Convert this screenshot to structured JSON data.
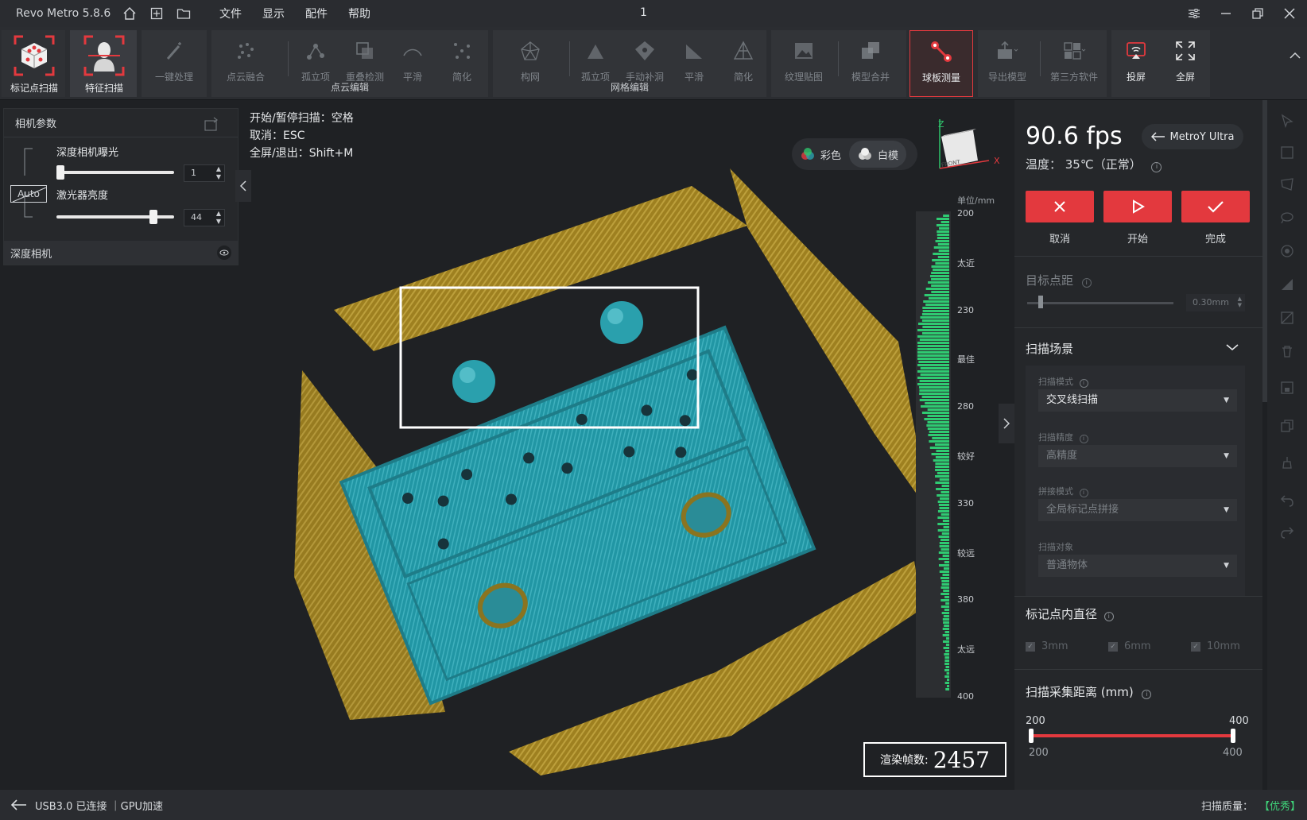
{
  "titlebar": {
    "app_title": "Revo Metro 5.8.6",
    "doc_title": "1",
    "menu": [
      "文件",
      "显示",
      "配件",
      "帮助"
    ],
    "icons": [
      "home-icon",
      "new-project-icon",
      "open-folder-icon"
    ]
  },
  "ribbon": {
    "scan_buttons": [
      "标记点扫描",
      "特征扫描"
    ],
    "one_click": "一键处理",
    "point_cloud_edit": {
      "label": "点云编辑",
      "items": [
        "点云融合",
        "孤立项",
        "重叠检测",
        "平滑",
        "简化"
      ]
    },
    "mesh_edit": {
      "label": "网格编辑",
      "items": [
        "构网",
        "孤立项",
        "手动补洞",
        "平滑",
        "简化"
      ]
    },
    "texture": "纹理贴图",
    "merge": "模型合并",
    "sphere_measure": "球板测量",
    "export": "导出模型",
    "third_party": "第三方软件",
    "cast": "投屏",
    "fullscreen": "全屏"
  },
  "left_panel": {
    "title": "相机参数",
    "auto_label": "Auto",
    "exposure_label": "深度相机曝光",
    "exposure_value": "1",
    "exposure_fraction": 0.0,
    "laser_label": "激光器亮度",
    "laser_value": "44",
    "laser_fraction": 0.85,
    "footer": "深度相机"
  },
  "viewport": {
    "hints": [
      "开始/暂停扫描：空格",
      "取消：ESC",
      "全屏/退出：Shift+M"
    ],
    "mode_color": "彩色",
    "mode_white": "白模",
    "cube_label": "FRONT",
    "axis_z": "Z",
    "axis_x": "X",
    "scale_unit": "单位/mm",
    "scale_labels": [
      "200",
      "太近",
      "230",
      "最佳",
      "280",
      "较好",
      "330",
      "较远",
      "380",
      "太远",
      "400"
    ],
    "render_label": "渲染帧数:",
    "render_value": "2457"
  },
  "right_panel": {
    "fps": "90.6 fps",
    "device": "MetroY Ultra",
    "temperature": "温度： 35℃（正常）",
    "cancel": "取消",
    "start": "开始",
    "finish": "完成",
    "target_point_label": "目标点距",
    "target_point_value": "0.30mm",
    "scene_title": "扫描场景",
    "scan_mode_label": "扫描模式",
    "scan_mode_value": "交叉线扫描",
    "precision_label": "扫描精度",
    "precision_value": "高精度",
    "stitch_label": "拼接模式",
    "stitch_value": "全局标记点拼接",
    "object_label": "扫描对象",
    "object_value": "普通物体",
    "marker_title": "标记点内直径",
    "marker_options": [
      "3mm",
      "6mm",
      "10mm"
    ],
    "distance_title": "扫描采集距离 (mm)",
    "distance_min": "200",
    "distance_max": "400",
    "distance_low": "200",
    "distance_high": "400"
  },
  "statusbar": {
    "connection": "USB3.0 已连接 ｜GPU加速",
    "quality_label": "扫描质量：",
    "quality_value": "【优秀】"
  },
  "colors": {
    "accent_red": "#e3393e",
    "scan_teal": "#2a9aa8",
    "scan_gold": "#c9a227",
    "quality_green": "#3fd67a"
  }
}
